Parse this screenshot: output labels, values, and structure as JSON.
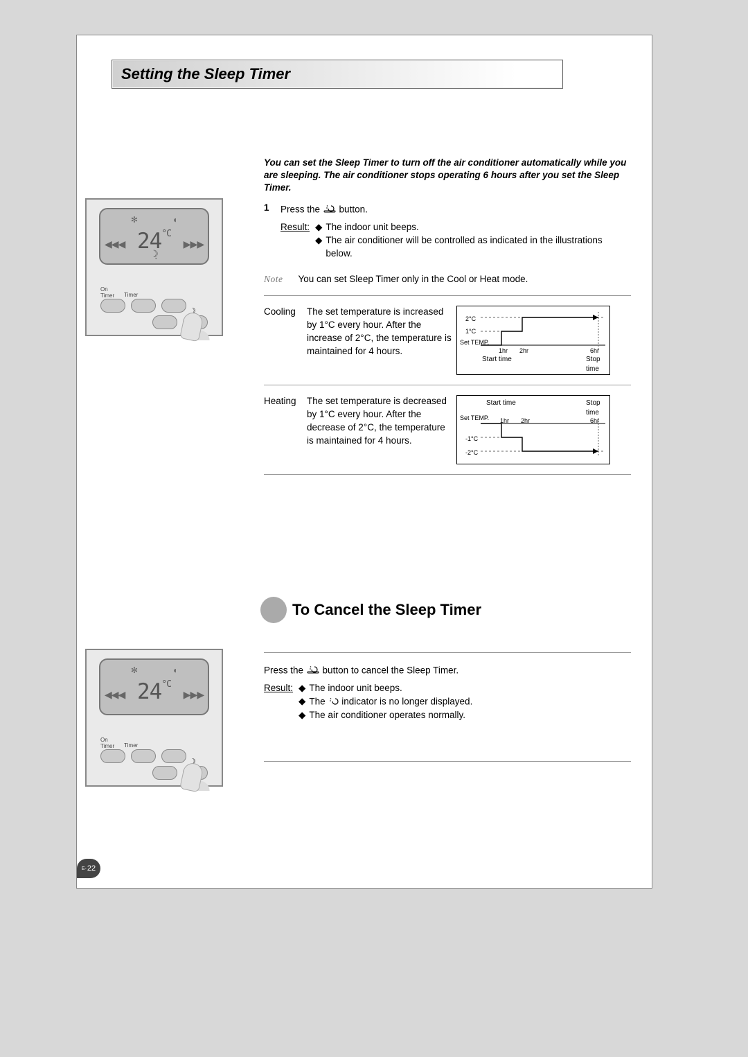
{
  "page": {
    "title": "Setting the Sleep Timer",
    "intro": "You can set the Sleep Timer to turn off the air conditioner automatically while you are sleeping. The air conditioner stops operating 6 hours after you set the Sleep Timer.",
    "page_num_prefix": "E-",
    "page_num": "22"
  },
  "remote": {
    "temp_display": "24",
    "temp_unit": "°C",
    "label_on_timer": "On\nTimer",
    "label_timer": "Timer"
  },
  "step1": {
    "num": "1",
    "text_before": "Press the ",
    "text_after": " button.",
    "result_label": "Result:",
    "bullets": [
      "The indoor unit beeps.",
      "The air conditioner will be controlled as indicated in the illustrations below."
    ],
    "note_label": "Note",
    "note_text": "You can set Sleep Timer only in the Cool or Heat mode."
  },
  "cooling": {
    "label": "Cooling",
    "text": "The set temperature is increased by 1°C every hour. After the increase of 2°C, the temperature is maintained for 4 hours."
  },
  "heating": {
    "label": "Heating",
    "text": "The set temperature is decreased by 1°C every hour. After the decrease of 2°C, the temperature is maintained for 4 hours."
  },
  "chart_data": [
    {
      "type": "line",
      "name": "cooling",
      "x_unit": "hr",
      "y_unit": "°C relative to set temperature",
      "points": [
        {
          "hr": 0,
          "delta_c": 0,
          "label": "Start time"
        },
        {
          "hr": 1,
          "delta_c": 1
        },
        {
          "hr": 2,
          "delta_c": 2
        },
        {
          "hr": 6,
          "delta_c": 2,
          "label": "Stop time"
        }
      ],
      "y_ticks": [
        "2°C",
        "1°C"
      ],
      "x_ticks": [
        "1hr",
        "2hr",
        "6hr"
      ],
      "y_axis_label": "Set TEMP.",
      "start_label": "Start time",
      "stop_label": "Stop time"
    },
    {
      "type": "line",
      "name": "heating",
      "x_unit": "hr",
      "y_unit": "°C relative to set temperature",
      "points": [
        {
          "hr": 0,
          "delta_c": 0,
          "label": "Start time"
        },
        {
          "hr": 1,
          "delta_c": -1
        },
        {
          "hr": 2,
          "delta_c": -2
        },
        {
          "hr": 6,
          "delta_c": -2,
          "label": "Stop time"
        }
      ],
      "y_ticks": [
        "-1°C",
        "-2°C"
      ],
      "x_ticks": [
        "1hr",
        "2hr",
        "6hr"
      ],
      "y_axis_label": "Set TEMP.",
      "start_label": "Start time",
      "stop_label": "Stop time"
    }
  ],
  "cancel": {
    "heading": "To Cancel the Sleep Timer",
    "text_before": "Press the ",
    "text_after": " button to cancel the Sleep Timer.",
    "result_label": "Result:",
    "bullets_pre": "The indoor unit beeps.",
    "bullet2_before": "The ",
    "bullet2_after": " indicator is no longer displayed.",
    "bullet3": "The air conditioner operates normally."
  },
  "icons": {
    "sleep_button": "sleep-button-icon",
    "sleep_indicator": "sleep-indicator-icon"
  }
}
